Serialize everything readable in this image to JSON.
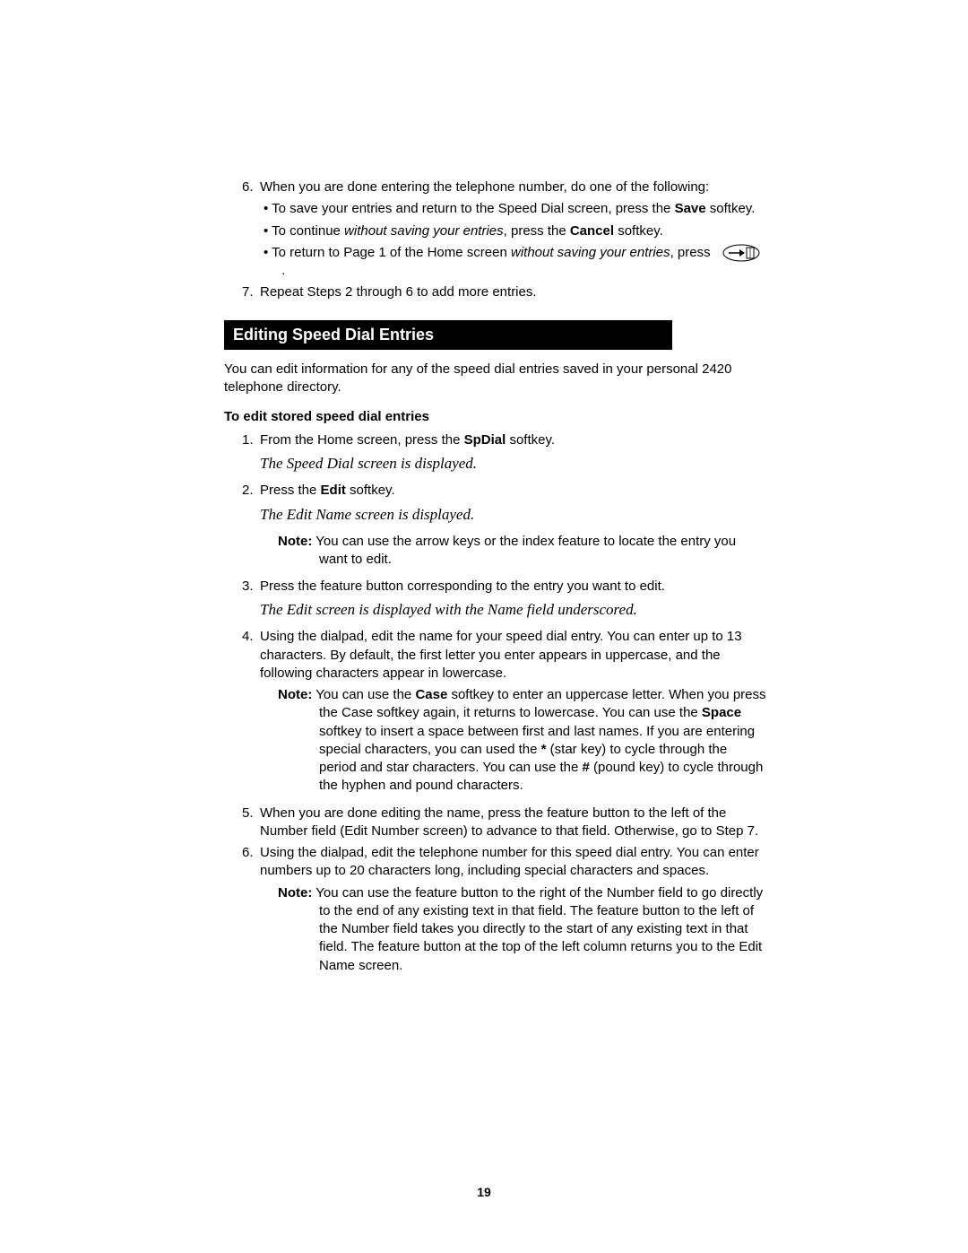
{
  "top": {
    "step6": {
      "num": "6.",
      "lead": "When you are done entering the telephone number, do one of the following:",
      "b1a": "To save your entries and return to the Speed Dial screen, press the ",
      "b1_bold": "Save",
      "b1c": " softkey.",
      "b2a": "To continue ",
      "b2_i": "without saving your entries",
      "b2b": ", press the ",
      "b2_bold": "Cancel",
      "b2c": " softkey.",
      "b3a": "To return to Page 1 of the Home screen ",
      "b3_i": "without saving your entries",
      "b3b": ", press",
      "b3c": "."
    },
    "step7": {
      "num": "7.",
      "text": "Repeat Steps 2 through 6 to add more entries."
    }
  },
  "heading": "Editing Speed Dial Entries",
  "intro": "You can edit information for any of the speed dial entries saved in your personal 2420 telephone directory.",
  "sub": "To edit stored speed dial entries",
  "edit": {
    "s1": {
      "num": "1.",
      "a": "From the Home screen, press the ",
      "bold": "SpDial",
      "b": " softkey."
    },
    "r1": "The Speed Dial screen is displayed.",
    "s2": {
      "num": "2.",
      "a": "Press the ",
      "bold": "Edit",
      "b": " softkey."
    },
    "r2": "The Edit Name screen is displayed.",
    "n2": {
      "label": "Note:",
      "text": "  You can use the arrow keys or the index feature to locate the entry you want to edit."
    },
    "s3": {
      "num": "3.",
      "text": "Press the feature button corresponding to the entry you want to edit."
    },
    "r3": "The Edit screen is displayed with the Name field underscored.",
    "s4": {
      "num": "4.",
      "text": "Using the dialpad, edit the name for your speed dial entry. You can enter up to 13 characters. By default, the first letter you enter appears in uppercase, and the following characters appear in lowercase."
    },
    "n4": {
      "label": "Note:",
      "a": "  You can use the ",
      "b_case": "Case",
      "b": " softkey to enter an uppercase letter. When you press the Case softkey again, it returns to lowercase. You can use the ",
      "b_space": "Space",
      "c": " softkey to insert a space between first and last names. If you are entering special characters, you can used the ",
      "b_star": "*",
      "d": " (star key) to cycle through the period and star characters. You can use the ",
      "b_pound": "#",
      "e": " (pound key) to cycle through the hyphen and pound characters."
    },
    "s5": {
      "num": "5.",
      "text": "When you are done editing the name, press the feature button to the left of the Number field (Edit Number screen) to advance to that field. Otherwise, go to Step 7."
    },
    "s6": {
      "num": "6.",
      "text": "Using the dialpad, edit the telephone number for this speed dial entry. You can enter numbers up to 20 characters long, including special characters and spaces."
    },
    "n6": {
      "label": "Note:",
      "text": "  You can use the feature button to the right of the Number field to go directly to the end of any existing text in that field. The feature button to the left of the Number field takes you directly to the start of any existing text in that field. The feature button at the top of the left column returns you to the Edit Name screen."
    }
  },
  "pagenum": "19"
}
